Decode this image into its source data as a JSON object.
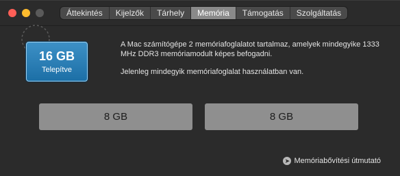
{
  "tabs": [
    {
      "label": "Áttekintés"
    },
    {
      "label": "Kijelzők"
    },
    {
      "label": "Tárhely"
    },
    {
      "label": "Memória"
    },
    {
      "label": "Támogatás"
    },
    {
      "label": "Szolgáltatás"
    }
  ],
  "active_tab": "Memória",
  "memory": {
    "total": "16 GB",
    "status": "Telepítve",
    "description": "A Mac számítógépe 2 memóriafoglalatot tartalmaz, amelyek mindegyike 1333 MHz DDR3 memóriamodult képes befogadni.",
    "usage": "Jelenleg mindegyik memóriafoglalat használatban van."
  },
  "slots": [
    {
      "size": "8 GB"
    },
    {
      "size": "8 GB"
    }
  ],
  "guide_link": "Memóriabővítési útmutató",
  "colors": {
    "accent": "#2b82bd",
    "slot": "#8f8f8f",
    "background": "#2b2b2b"
  },
  "icons": {
    "guide": "arrow-right-circle-icon"
  }
}
